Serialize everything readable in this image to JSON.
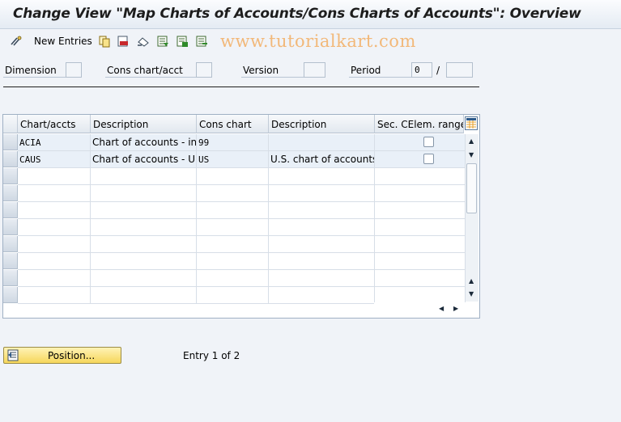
{
  "window": {
    "title": "Change View \"Map Charts of Accounts/Cons Charts of Accounts\": Overview"
  },
  "toolbar": {
    "new_entries_label": "New Entries",
    "watermark": "www.tutorialkart.com"
  },
  "selection": {
    "dimension_label": "Dimension",
    "dimension_value": "",
    "cons_chart_label": "Cons chart/acct",
    "cons_chart_value": "",
    "version_label": "Version",
    "version_value": "",
    "period_label": "Period",
    "period_value": "0",
    "period_separator": "/",
    "year_value": ""
  },
  "table": {
    "columns": [
      "Chart/accts",
      "Description",
      "Cons chart",
      "Description",
      "Sec. CElem. range"
    ],
    "rows": [
      {
        "chart": "ACIA",
        "description": "Chart of accounts - int…",
        "cons_chart": "99",
        "cons_description": "",
        "sec_range": false
      },
      {
        "chart": "CAUS",
        "description": "Chart of accounts - Un…",
        "cons_chart": "US",
        "cons_description": "U.S. chart of accounts",
        "sec_range": false
      }
    ]
  },
  "footer": {
    "position_button_label": "Position...",
    "entry_info": "Entry 1 of 2"
  },
  "colors": {
    "button_yellow": "#f6d65b",
    "header_gradient_top": "#f7f9fb",
    "filled_row": "#e9f0f8",
    "watermark": "#f2b879"
  }
}
